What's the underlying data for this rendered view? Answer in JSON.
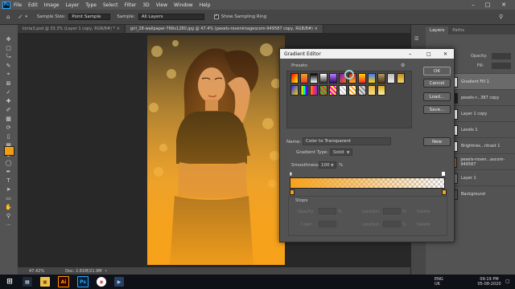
{
  "menu": {
    "logo": "Ps",
    "items": [
      "File",
      "Edit",
      "Image",
      "Layer",
      "Type",
      "Select",
      "Filter",
      "3D",
      "View",
      "Window",
      "Help"
    ]
  },
  "options": {
    "sample_size_label": "Sample Size:",
    "sample_size_value": "Point Sample",
    "sample_label": "Sample:",
    "sample_value": "All Layers",
    "show_ring_label": "Show Sampling Ring"
  },
  "tabs": [
    "kinta3.psd @ 33.3% (Layer 1 copy, RGB/8#) *",
    "girl_28-wallpaper-768x1280.jpg @ 47.4% (pexels-rovenimagescom-949587 copy, RGB/8#)"
  ],
  "status": {
    "zoom": "47.42%",
    "doc": "Doc: 2.81M/21.9M"
  },
  "panel": {
    "tabs": [
      "Layers",
      "Paths"
    ],
    "opacity_label": "Opacity:",
    "fill_label": "Fill:",
    "layers": [
      "Gradient Fill 1",
      "pexels-r...387 copy",
      "Layer 1 copy",
      "Levels 1",
      "Brightnes...ntrast 1",
      "pexels-roven...ascom-949587",
      "Layer 1",
      "Background"
    ]
  },
  "dialog": {
    "title": "Gradient Editor",
    "presets_label": "Presets",
    "buttons": {
      "ok": "OK",
      "cancel": "Cancel",
      "load": "Load...",
      "save": "Save...",
      "new": "New"
    },
    "name_label": "Name:",
    "name_value": "Color to Transparent",
    "gradient_type_label": "Gradient Type:",
    "gradient_type_value": "Solid",
    "smoothness_label": "Smoothness:",
    "smoothness_value": "100",
    "smoothness_unit": "%",
    "stops_label": "Stops",
    "stops_opacity_label": "Opacity:",
    "stops_location_label": "Location:",
    "stops_color_label": "Color:",
    "stops_delete_label": "Delete",
    "stops_percent": "%",
    "gradient_color": "#f7a11a"
  },
  "clock": {
    "time": "09:19 PM",
    "date": "05-08-2020",
    "lang": "ENG UK"
  },
  "taskbar_apps": [
    "Ai",
    "Ps"
  ],
  "colors": {
    "foreground": "#f39c12",
    "background": "#d81b8f",
    "accent": "#31a8ff"
  }
}
